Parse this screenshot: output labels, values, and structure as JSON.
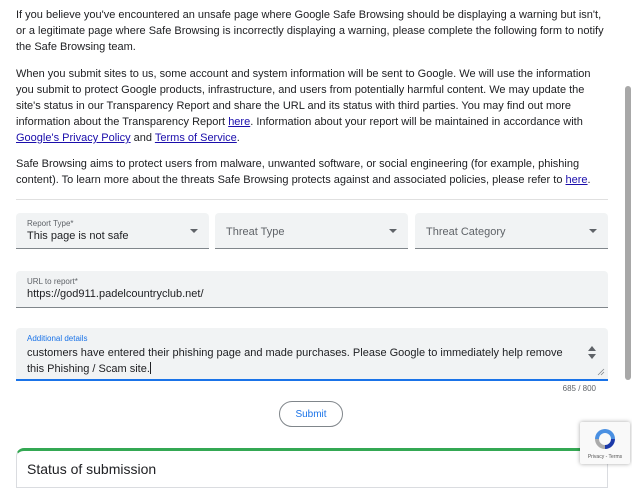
{
  "intro": {
    "p1": "If you believe you've encountered an unsafe page where Google Safe Browsing should be displaying a warning but isn't, or a legitimate page where Safe Browsing is incorrectly displaying a warning, please complete the following form to notify the Safe Browsing team.",
    "p2_a": "When you submit sites to us, some account and system information will be sent to Google. We will use the information you submit to protect Google products, infrastructure, and users from potentially harmful content. We may update the site's status in our Transparency Report and share the URL and its status with third parties. You may find out more information about the Transparency Report ",
    "p2_link1": "here",
    "p2_b": ". Information about your report will be maintained in accordance with ",
    "p2_link2": "Google's Privacy Policy",
    "p2_c": " and ",
    "p2_link3": "Terms of Service",
    "p2_d": ".",
    "p3_a": "Safe Browsing aims to protect users from malware, unwanted software, or social engineering (for example, phishing content). To learn more about the threats Safe Browsing protects against and associated policies, please refer to ",
    "p3_link": "here",
    "p3_b": "."
  },
  "form": {
    "report_type": {
      "label": "Report Type*",
      "value": "This page is not safe"
    },
    "threat_type": {
      "placeholder": "Threat Type"
    },
    "threat_category": {
      "placeholder": "Threat Category"
    },
    "url": {
      "label": "URL to report*",
      "value": "https://god911.padelcountryclub.net/"
    },
    "details": {
      "label": "Additional details",
      "value": "customers have entered their phishing page and made purchases. Please Google to immediately help remove this Phishing / Scam site."
    },
    "counter": "685 / 800",
    "submit_label": "Submit"
  },
  "status": {
    "title": "Status of submission"
  },
  "recaptcha": {
    "links": "Privacy - Terms"
  },
  "colors": {
    "accent": "#1a73e8",
    "link": "#1a0dab",
    "status_border": "#34a853"
  }
}
